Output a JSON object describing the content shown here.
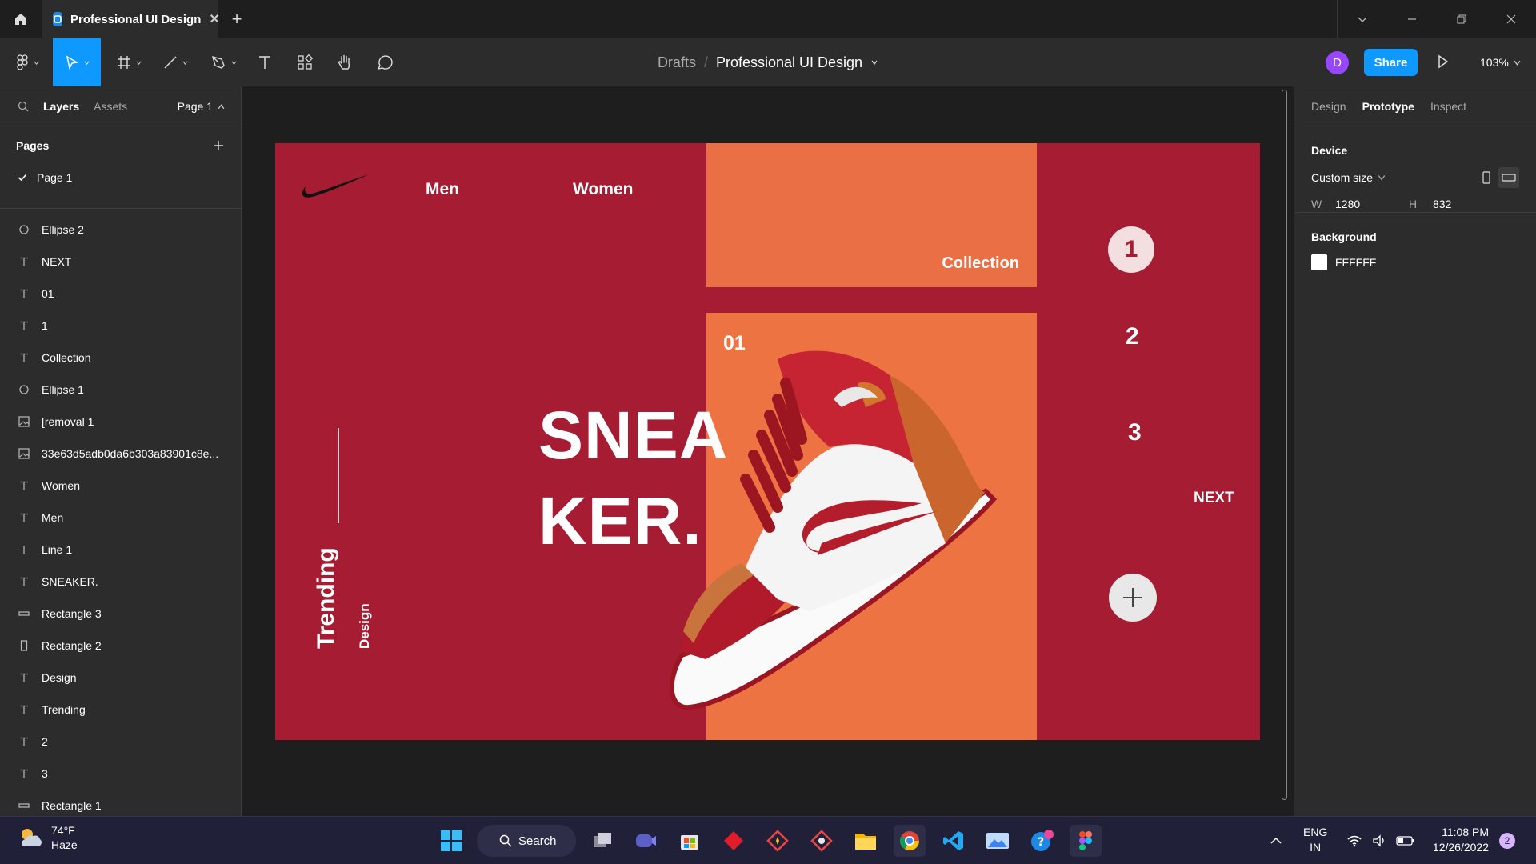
{
  "titlebar": {
    "tab_title": "Professional UI Design",
    "new_tab": "+"
  },
  "toolbar": {
    "breadcrumb_root": "Drafts",
    "breadcrumb_sep": "/",
    "file_name": "Professional UI Design",
    "avatar_initial": "D",
    "share_label": "Share",
    "zoom": "103%"
  },
  "left_panel": {
    "tabs": {
      "layers": "Layers",
      "assets": "Assets"
    },
    "page_selector": "Page 1",
    "pages_heading": "Pages",
    "pages": [
      "Page 1"
    ],
    "layers": [
      {
        "icon": "ellipse-icon",
        "name": "Ellipse 2"
      },
      {
        "icon": "text-icon",
        "name": "NEXT"
      },
      {
        "icon": "text-icon",
        "name": "01"
      },
      {
        "icon": "text-icon",
        "name": "1"
      },
      {
        "icon": "text-icon",
        "name": "Collection"
      },
      {
        "icon": "ellipse-icon",
        "name": "Ellipse 1"
      },
      {
        "icon": "image-icon",
        "name": "[removal 1"
      },
      {
        "icon": "image-icon",
        "name": "33e63d5adb0da6b303a83901c8e..."
      },
      {
        "icon": "text-icon",
        "name": "Women"
      },
      {
        "icon": "text-icon",
        "name": "Men"
      },
      {
        "icon": "line-icon",
        "name": "Line 1"
      },
      {
        "icon": "text-icon",
        "name": "SNEAKER."
      },
      {
        "icon": "rectangle-icon",
        "name": "Rectangle 3"
      },
      {
        "icon": "rectangle-vertical-icon",
        "name": "Rectangle 2"
      },
      {
        "icon": "text-icon",
        "name": "Design"
      },
      {
        "icon": "text-icon",
        "name": "Trending"
      },
      {
        "icon": "text-icon",
        "name": "2"
      },
      {
        "icon": "text-icon",
        "name": "3"
      },
      {
        "icon": "rectangle-icon",
        "name": "Rectangle 1"
      }
    ]
  },
  "design": {
    "nav_men": "Men",
    "nav_women": "Women",
    "collection": "Collection",
    "number_01": "01",
    "headline": "SNEA\nKER.",
    "trending": "Trending",
    "design_label": "Design",
    "step_1": "1",
    "step_2": "2",
    "step_3": "3",
    "next": "NEXT",
    "colors": {
      "background": "#a61d33",
      "panel": "#ee7343",
      "circle": "#f3dfe0"
    }
  },
  "help": "?",
  "right_panel": {
    "tabs": {
      "design": "Design",
      "prototype": "Prototype",
      "inspect": "Inspect"
    },
    "device_heading": "Device",
    "device_size": "Custom size",
    "w_label": "W",
    "w_value": "1280",
    "h_label": "H",
    "h_value": "832",
    "background_heading": "Background",
    "background_value": "FFFFFF"
  },
  "taskbar": {
    "temperature": "74°F",
    "condition": "Haze",
    "search": "Search",
    "lang": "ENG",
    "region": "IN",
    "time": "11:08 PM",
    "date": "12/26/2022",
    "notifications": "2"
  }
}
